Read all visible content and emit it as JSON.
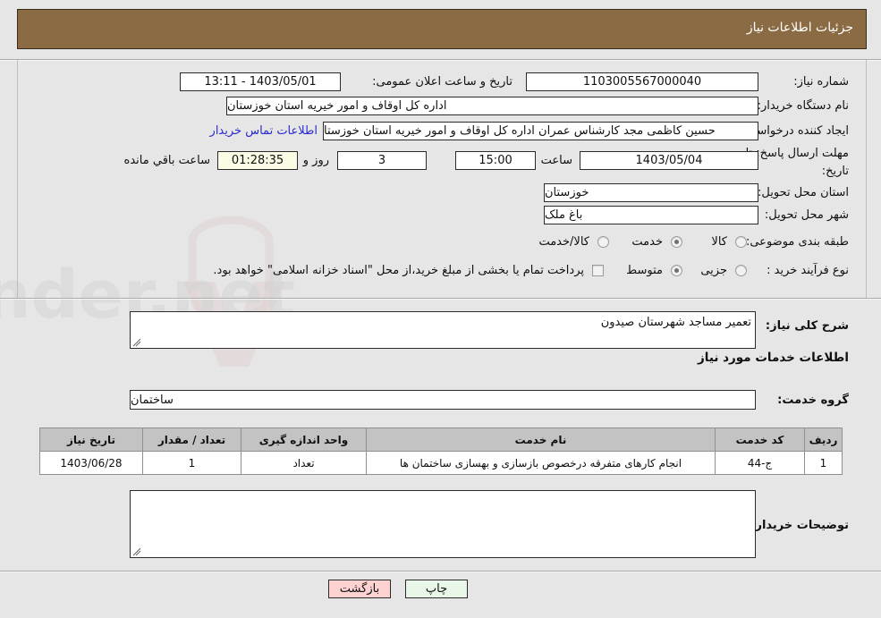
{
  "header": {
    "title": "جزئیات اطلاعات نیاز"
  },
  "colors": {
    "header_bg": "#8b6b43",
    "header_text": "#ffffff",
    "page_bg": "#e6e6e6",
    "link": "#2a2ad0",
    "table_header_bg": "#c3c3c3",
    "countdown_bg": "#fbfbe6",
    "print_button_bg": "#e9f7e9",
    "back_button_bg": "#ffd2d2"
  },
  "form": {
    "need_number_label": "شماره نیاز:",
    "need_number_value": "1103005567000040",
    "announce_datetime_label": "تاریخ و ساعت اعلان عمومی:",
    "announce_datetime_value": "1403/05/01 - 13:11",
    "buyer_org_label": "نام دستگاه خریدار:",
    "buyer_org_value": "اداره کل اوقاف و امور خیریه استان خوزستان",
    "requester_label": "ایجاد کننده درخواست:",
    "requester_value": "حسین کاظمی مجد کارشناس عمران اداره کل اوقاف و امور خیریه استان خوزستا",
    "contact_link": "اطلاعات تماس خریدار",
    "deadline_label_line1": "مهلت ارسال پاسخ: تا",
    "deadline_label_line2": "تاریخ:",
    "deadline_date": "1403/05/04",
    "deadline_hour_label": "ساعت",
    "deadline_time": "15:00",
    "remaining_days": "3",
    "remaining_days_label": "روز و",
    "remaining_clock": "01:28:35",
    "remaining_suffix": "ساعت باقي مانده",
    "province_label": "استان محل تحویل:",
    "province_value": "خوزستان",
    "city_label": "شهر محل تحویل:",
    "city_value": "باغ ملک",
    "category_label": "طبقه بندی موضوعی:",
    "category_options": [
      "کالا",
      "خدمت",
      "کالا/خدمت"
    ],
    "category_selected_index": 1,
    "process_label": "نوع فرآیند خرید :",
    "process_options": [
      "جزیی",
      "متوسط"
    ],
    "process_selected_index": 1,
    "treasury_checkbox_label": "پرداخت تمام یا بخشی از مبلغ خرید،از محل \"اسناد خزانه اسلامی\" خواهد بود.",
    "treasury_checked": false
  },
  "description": {
    "label": "شرح کلی نیاز:",
    "value": "تعمیر مساجد شهرستان صیدون"
  },
  "services": {
    "section_title": "اطلاعات خدمات مورد نیاز",
    "group_label": "گروه خدمت:",
    "group_value": "ساختمان",
    "columns": [
      "ردیف",
      "کد خدمت",
      "نام خدمت",
      "واحد اندازه گیری",
      "تعداد / مقدار",
      "تاریخ نیاز"
    ],
    "rows": [
      {
        "index": "1",
        "code": "ج-44",
        "name": "انجام کارهای متفرقه درخصوص بازسازی و بهسازی ساختمان ها",
        "unit": "تعداد",
        "quantity": "1",
        "need_date": "1403/06/28"
      }
    ]
  },
  "buyer_notes": {
    "label": "توضیحات خریدار:",
    "value": ""
  },
  "footer": {
    "print_label": "چاپ",
    "back_label": "بازگشت"
  },
  "watermark": {
    "text": "AnaTender.net"
  }
}
